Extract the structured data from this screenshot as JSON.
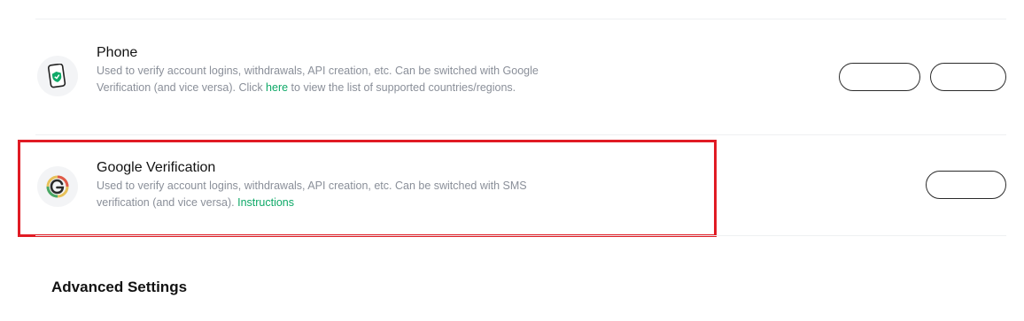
{
  "phone": {
    "title": "Phone",
    "desc_prefix": "Used to verify account logins, withdrawals, API creation, etc. Can be switched with Google Verification (and vice versa). Click ",
    "link_here": "here",
    "desc_suffix": " to view the list of supported countries/regions.",
    "icon": "phone-shield-icon",
    "button_1_label": "",
    "button_2_label": ""
  },
  "google": {
    "title": "Google Verification",
    "desc_prefix": "Used to verify account logins, withdrawals, API creation, etc. Can be switched with SMS verification (and vice versa). ",
    "link_instructions": "Instructions",
    "icon": "google-authenticator-icon",
    "button_label": ""
  },
  "advanced": {
    "title": "Advanced Settings"
  },
  "colors": {
    "accent_link": "#0fa968",
    "highlight_border": "#e01b24",
    "description_text": "#8a8f99"
  }
}
